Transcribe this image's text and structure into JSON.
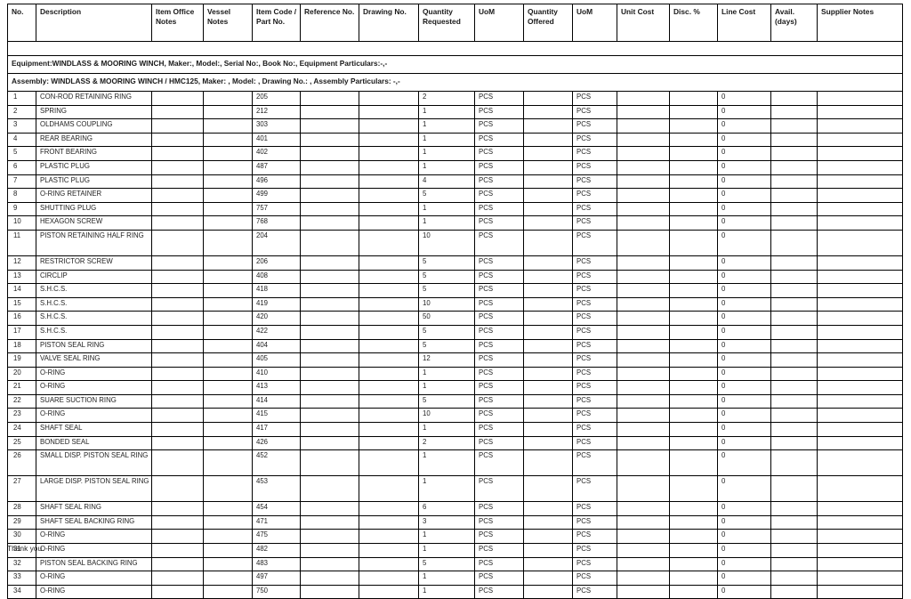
{
  "document": {
    "footer_note": "Thank you."
  },
  "table": {
    "columns": [
      {
        "key": "no",
        "label": "No."
      },
      {
        "key": "desc",
        "label": "Description"
      },
      {
        "key": "ion",
        "label": "Item Office Notes"
      },
      {
        "key": "vn",
        "label": "Vessel Notes"
      },
      {
        "key": "code",
        "label": "Item Code / Part No."
      },
      {
        "key": "ref",
        "label": "Reference No."
      },
      {
        "key": "dwg",
        "label": "Drawing No."
      },
      {
        "key": "qreq",
        "label": "Quantity Requested"
      },
      {
        "key": "uom1",
        "label": "UoM"
      },
      {
        "key": "qoff",
        "label": "Quantity Offered"
      },
      {
        "key": "uom2",
        "label": "UoM"
      },
      {
        "key": "unit",
        "label": "Unit Cost"
      },
      {
        "key": "disc",
        "label": "Disc. %"
      },
      {
        "key": "line",
        "label": "Line Cost"
      },
      {
        "key": "avail",
        "label": "Avail. (days)"
      },
      {
        "key": "supp",
        "label": "Supplier Notes"
      }
    ],
    "banners": [
      {
        "text": "Equipment:WINDLASS & MOORING WINCH, Maker:, Model:, Serial No:, Book No:, Equipment Particulars:-,-"
      },
      {
        "text": "Assembly: WINDLASS & MOORING WINCH / HMC125, Maker: , Model: , Drawing No.: , Assembly Particulars: -,-"
      }
    ],
    "rows": [
      {
        "no": "1",
        "desc": "CON-ROD RETAINING RING",
        "ion": "",
        "vn": "",
        "code": "205",
        "ref": "",
        "dwg": "",
        "qreq": "2",
        "uom1": "PCS",
        "qoff": "",
        "uom2": "PCS",
        "unit": "",
        "disc": "",
        "line": "0",
        "avail": "",
        "supp": ""
      },
      {
        "no": "2",
        "desc": "SPRING",
        "ion": "",
        "vn": "",
        "code": "212",
        "ref": "",
        "dwg": "",
        "qreq": "1",
        "uom1": "PCS",
        "qoff": "",
        "uom2": "PCS",
        "unit": "",
        "disc": "",
        "line": "0",
        "avail": "",
        "supp": ""
      },
      {
        "no": "3",
        "desc": "OLDHAMS COUPLING",
        "ion": "",
        "vn": "",
        "code": "303",
        "ref": "",
        "dwg": "",
        "qreq": "1",
        "uom1": "PCS",
        "qoff": "",
        "uom2": "PCS",
        "unit": "",
        "disc": "",
        "line": "0",
        "avail": "",
        "supp": ""
      },
      {
        "no": "4",
        "desc": "REAR BEARING",
        "ion": "",
        "vn": "",
        "code": "401",
        "ref": "",
        "dwg": "",
        "qreq": "1",
        "uom1": "PCS",
        "qoff": "",
        "uom2": "PCS",
        "unit": "",
        "disc": "",
        "line": "0",
        "avail": "",
        "supp": ""
      },
      {
        "no": "5",
        "desc": "FRONT BEARING",
        "ion": "",
        "vn": "",
        "code": "402",
        "ref": "",
        "dwg": "",
        "qreq": "1",
        "uom1": "PCS",
        "qoff": "",
        "uom2": "PCS",
        "unit": "",
        "disc": "",
        "line": "0",
        "avail": "",
        "supp": ""
      },
      {
        "no": "6",
        "desc": "PLASTIC PLUG",
        "ion": "",
        "vn": "",
        "code": "487",
        "ref": "",
        "dwg": "",
        "qreq": "1",
        "uom1": "PCS",
        "qoff": "",
        "uom2": "PCS",
        "unit": "",
        "disc": "",
        "line": "0",
        "avail": "",
        "supp": ""
      },
      {
        "no": "7",
        "desc": "PLASTIC PLUG",
        "ion": "",
        "vn": "",
        "code": "496",
        "ref": "",
        "dwg": "",
        "qreq": "4",
        "uom1": "PCS",
        "qoff": "",
        "uom2": "PCS",
        "unit": "",
        "disc": "",
        "line": "0",
        "avail": "",
        "supp": ""
      },
      {
        "no": "8",
        "desc": "O-RING RETAINER",
        "ion": "",
        "vn": "",
        "code": "499",
        "ref": "",
        "dwg": "",
        "qreq": "5",
        "uom1": "PCS",
        "qoff": "",
        "uom2": "PCS",
        "unit": "",
        "disc": "",
        "line": "0",
        "avail": "",
        "supp": ""
      },
      {
        "no": "9",
        "desc": "SHUTTING PLUG",
        "ion": "",
        "vn": "",
        "code": "757",
        "ref": "",
        "dwg": "",
        "qreq": "1",
        "uom1": "PCS",
        "qoff": "",
        "uom2": "PCS",
        "unit": "",
        "disc": "",
        "line": "0",
        "avail": "",
        "supp": ""
      },
      {
        "no": "10",
        "desc": "HEXAGON SCREW",
        "ion": "",
        "vn": "",
        "code": "768",
        "ref": "",
        "dwg": "",
        "qreq": "1",
        "uom1": "PCS",
        "qoff": "",
        "uom2": "PCS",
        "unit": "",
        "disc": "",
        "line": "0",
        "avail": "",
        "supp": ""
      },
      {
        "no": "11",
        "desc": "PISTON RETAINING HALF RING",
        "ion": "",
        "vn": "",
        "code": "204",
        "ref": "",
        "dwg": "",
        "qreq": "10",
        "uom1": "PCS",
        "qoff": "",
        "uom2": "PCS",
        "unit": "",
        "disc": "",
        "line": "0",
        "avail": "",
        "supp": "",
        "tall": true
      },
      {
        "no": "12",
        "desc": "RESTRICTOR SCREW",
        "ion": "",
        "vn": "",
        "code": "206",
        "ref": "",
        "dwg": "",
        "qreq": "5",
        "uom1": "PCS",
        "qoff": "",
        "uom2": "PCS",
        "unit": "",
        "disc": "",
        "line": "0",
        "avail": "",
        "supp": ""
      },
      {
        "no": "13",
        "desc": "CIRCLIP",
        "ion": "",
        "vn": "",
        "code": "408",
        "ref": "",
        "dwg": "",
        "qreq": "5",
        "uom1": "PCS",
        "qoff": "",
        "uom2": "PCS",
        "unit": "",
        "disc": "",
        "line": "0",
        "avail": "",
        "supp": ""
      },
      {
        "no": "14",
        "desc": "S.H.C.S.",
        "ion": "",
        "vn": "",
        "code": "418",
        "ref": "",
        "dwg": "",
        "qreq": "5",
        "uom1": "PCS",
        "qoff": "",
        "uom2": "PCS",
        "unit": "",
        "disc": "",
        "line": "0",
        "avail": "",
        "supp": ""
      },
      {
        "no": "15",
        "desc": "S.H.C.S.",
        "ion": "",
        "vn": "",
        "code": "419",
        "ref": "",
        "dwg": "",
        "qreq": "10",
        "uom1": "PCS",
        "qoff": "",
        "uom2": "PCS",
        "unit": "",
        "disc": "",
        "line": "0",
        "avail": "",
        "supp": ""
      },
      {
        "no": "16",
        "desc": "S.H.C.S.",
        "ion": "",
        "vn": "",
        "code": "420",
        "ref": "",
        "dwg": "",
        "qreq": "50",
        "uom1": "PCS",
        "qoff": "",
        "uom2": "PCS",
        "unit": "",
        "disc": "",
        "line": "0",
        "avail": "",
        "supp": ""
      },
      {
        "no": "17",
        "desc": "S.H.C.S.",
        "ion": "",
        "vn": "",
        "code": "422",
        "ref": "",
        "dwg": "",
        "qreq": "5",
        "uom1": "PCS",
        "qoff": "",
        "uom2": "PCS",
        "unit": "",
        "disc": "",
        "line": "0",
        "avail": "",
        "supp": ""
      },
      {
        "no": "18",
        "desc": "PISTON SEAL RING",
        "ion": "",
        "vn": "",
        "code": "404",
        "ref": "",
        "dwg": "",
        "qreq": "5",
        "uom1": "PCS",
        "qoff": "",
        "uom2": "PCS",
        "unit": "",
        "disc": "",
        "line": "0",
        "avail": "",
        "supp": ""
      },
      {
        "no": "19",
        "desc": "VALVE SEAL RING",
        "ion": "",
        "vn": "",
        "code": "405",
        "ref": "",
        "dwg": "",
        "qreq": "12",
        "uom1": "PCS",
        "qoff": "",
        "uom2": "PCS",
        "unit": "",
        "disc": "",
        "line": "0",
        "avail": "",
        "supp": ""
      },
      {
        "no": "20",
        "desc": "O-RING",
        "ion": "",
        "vn": "",
        "code": "410",
        "ref": "",
        "dwg": "",
        "qreq": "1",
        "uom1": "PCS",
        "qoff": "",
        "uom2": "PCS",
        "unit": "",
        "disc": "",
        "line": "0",
        "avail": "",
        "supp": ""
      },
      {
        "no": "21",
        "desc": "O-RING",
        "ion": "",
        "vn": "",
        "code": "413",
        "ref": "",
        "dwg": "",
        "qreq": "1",
        "uom1": "PCS",
        "qoff": "",
        "uom2": "PCS",
        "unit": "",
        "disc": "",
        "line": "0",
        "avail": "",
        "supp": ""
      },
      {
        "no": "22",
        "desc": "SUARE SUCTION RING",
        "ion": "",
        "vn": "",
        "code": "414",
        "ref": "",
        "dwg": "",
        "qreq": "5",
        "uom1": "PCS",
        "qoff": "",
        "uom2": "PCS",
        "unit": "",
        "disc": "",
        "line": "0",
        "avail": "",
        "supp": ""
      },
      {
        "no": "23",
        "desc": "O-RING",
        "ion": "",
        "vn": "",
        "code": "415",
        "ref": "",
        "dwg": "",
        "qreq": "10",
        "uom1": "PCS",
        "qoff": "",
        "uom2": "PCS",
        "unit": "",
        "disc": "",
        "line": "0",
        "avail": "",
        "supp": ""
      },
      {
        "no": "24",
        "desc": "SHAFT SEAL",
        "ion": "",
        "vn": "",
        "code": "417",
        "ref": "",
        "dwg": "",
        "qreq": "1",
        "uom1": "PCS",
        "qoff": "",
        "uom2": "PCS",
        "unit": "",
        "disc": "",
        "line": "0",
        "avail": "",
        "supp": ""
      },
      {
        "no": "25",
        "desc": "BONDED SEAL",
        "ion": "",
        "vn": "",
        "code": "426",
        "ref": "",
        "dwg": "",
        "qreq": "2",
        "uom1": "PCS",
        "qoff": "",
        "uom2": "PCS",
        "unit": "",
        "disc": "",
        "line": "0",
        "avail": "",
        "supp": ""
      },
      {
        "no": "26",
        "desc": "SMALL DISP. PISTON SEAL RING",
        "ion": "",
        "vn": "",
        "code": "452",
        "ref": "",
        "dwg": "",
        "qreq": "1",
        "uom1": "PCS",
        "qoff": "",
        "uom2": "PCS",
        "unit": "",
        "disc": "",
        "line": "0",
        "avail": "",
        "supp": "",
        "tall": true
      },
      {
        "no": "27",
        "desc": "LARGE DISP. PISTON SEAL RING",
        "ion": "",
        "vn": "",
        "code": "453",
        "ref": "",
        "dwg": "",
        "qreq": "1",
        "uom1": "PCS",
        "qoff": "",
        "uom2": "PCS",
        "unit": "",
        "disc": "",
        "line": "0",
        "avail": "",
        "supp": "",
        "tall": true
      },
      {
        "no": "28",
        "desc": "SHAFT SEAL RING",
        "ion": "",
        "vn": "",
        "code": "454",
        "ref": "",
        "dwg": "",
        "qreq": "6",
        "uom1": "PCS",
        "qoff": "",
        "uom2": "PCS",
        "unit": "",
        "disc": "",
        "line": "0",
        "avail": "",
        "supp": ""
      },
      {
        "no": "29",
        "desc": "SHAFT SEAL BACKING RING",
        "ion": "",
        "vn": "",
        "code": "471",
        "ref": "",
        "dwg": "",
        "qreq": "3",
        "uom1": "PCS",
        "qoff": "",
        "uom2": "PCS",
        "unit": "",
        "disc": "",
        "line": "0",
        "avail": "",
        "supp": ""
      },
      {
        "no": "30",
        "desc": "O-RING",
        "ion": "",
        "vn": "",
        "code": "475",
        "ref": "",
        "dwg": "",
        "qreq": "1",
        "uom1": "PCS",
        "qoff": "",
        "uom2": "PCS",
        "unit": "",
        "disc": "",
        "line": "0",
        "avail": "",
        "supp": ""
      },
      {
        "no": "31",
        "desc": "O-RING",
        "ion": "",
        "vn": "",
        "code": "482",
        "ref": "",
        "dwg": "",
        "qreq": "1",
        "uom1": "PCS",
        "qoff": "",
        "uom2": "PCS",
        "unit": "",
        "disc": "",
        "line": "0",
        "avail": "",
        "supp": ""
      },
      {
        "no": "32",
        "desc": "PISTON SEAL BACKING RING",
        "ion": "",
        "vn": "",
        "code": "483",
        "ref": "",
        "dwg": "",
        "qreq": "5",
        "uom1": "PCS",
        "qoff": "",
        "uom2": "PCS",
        "unit": "",
        "disc": "",
        "line": "0",
        "avail": "",
        "supp": ""
      },
      {
        "no": "33",
        "desc": "O-RING",
        "ion": "",
        "vn": "",
        "code": "497",
        "ref": "",
        "dwg": "",
        "qreq": "1",
        "uom1": "PCS",
        "qoff": "",
        "uom2": "PCS",
        "unit": "",
        "disc": "",
        "line": "0",
        "avail": "",
        "supp": ""
      },
      {
        "no": "34",
        "desc": "O-RING",
        "ion": "",
        "vn": "",
        "code": "750",
        "ref": "",
        "dwg": "",
        "qreq": "1",
        "uom1": "PCS",
        "qoff": "",
        "uom2": "PCS",
        "unit": "",
        "disc": "",
        "line": "0",
        "avail": "",
        "supp": ""
      }
    ]
  }
}
